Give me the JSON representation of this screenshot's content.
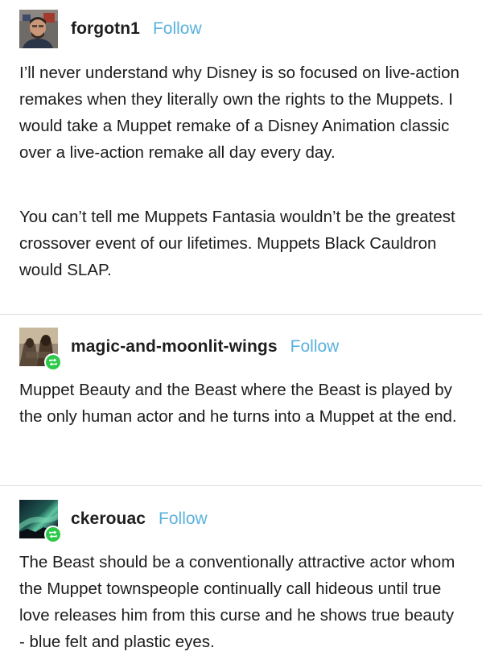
{
  "posts": [
    {
      "username": "forgotn1",
      "follow_label": "Follow",
      "reblogged": false,
      "paragraphs": [
        "I’ll never understand why Disney is so focused on live-action remakes when they literally own the rights to the Muppets. I would take a Muppet remake of a Disney Animation classic over a live-action remake all day every day.",
        "You can’t tell me Muppets Fantasia wouldn’t be the greatest crossover event of our lifetimes. Muppets Black Cauldron would SLAP."
      ]
    },
    {
      "username": "magic-and-moonlit-wings",
      "follow_label": "Follow",
      "reblogged": true,
      "paragraphs": [
        "Muppet Beauty and the Beast where the Beast is played by the only human actor and he turns into a Muppet at the end."
      ]
    },
    {
      "username": "ckerouac",
      "follow_label": "Follow",
      "reblogged": true,
      "paragraphs": [
        "The Beast should be a conventionally attractive actor whom the Muppet townspeople continually call hideous until true love releases him from this curse and he shows true beauty - blue felt and plastic eyes."
      ]
    }
  ],
  "colors": {
    "follow": "#5ab2dd",
    "reblog_badge": "#2dc94a",
    "divider": "#dcdcdc",
    "text": "#1c1c1c"
  }
}
